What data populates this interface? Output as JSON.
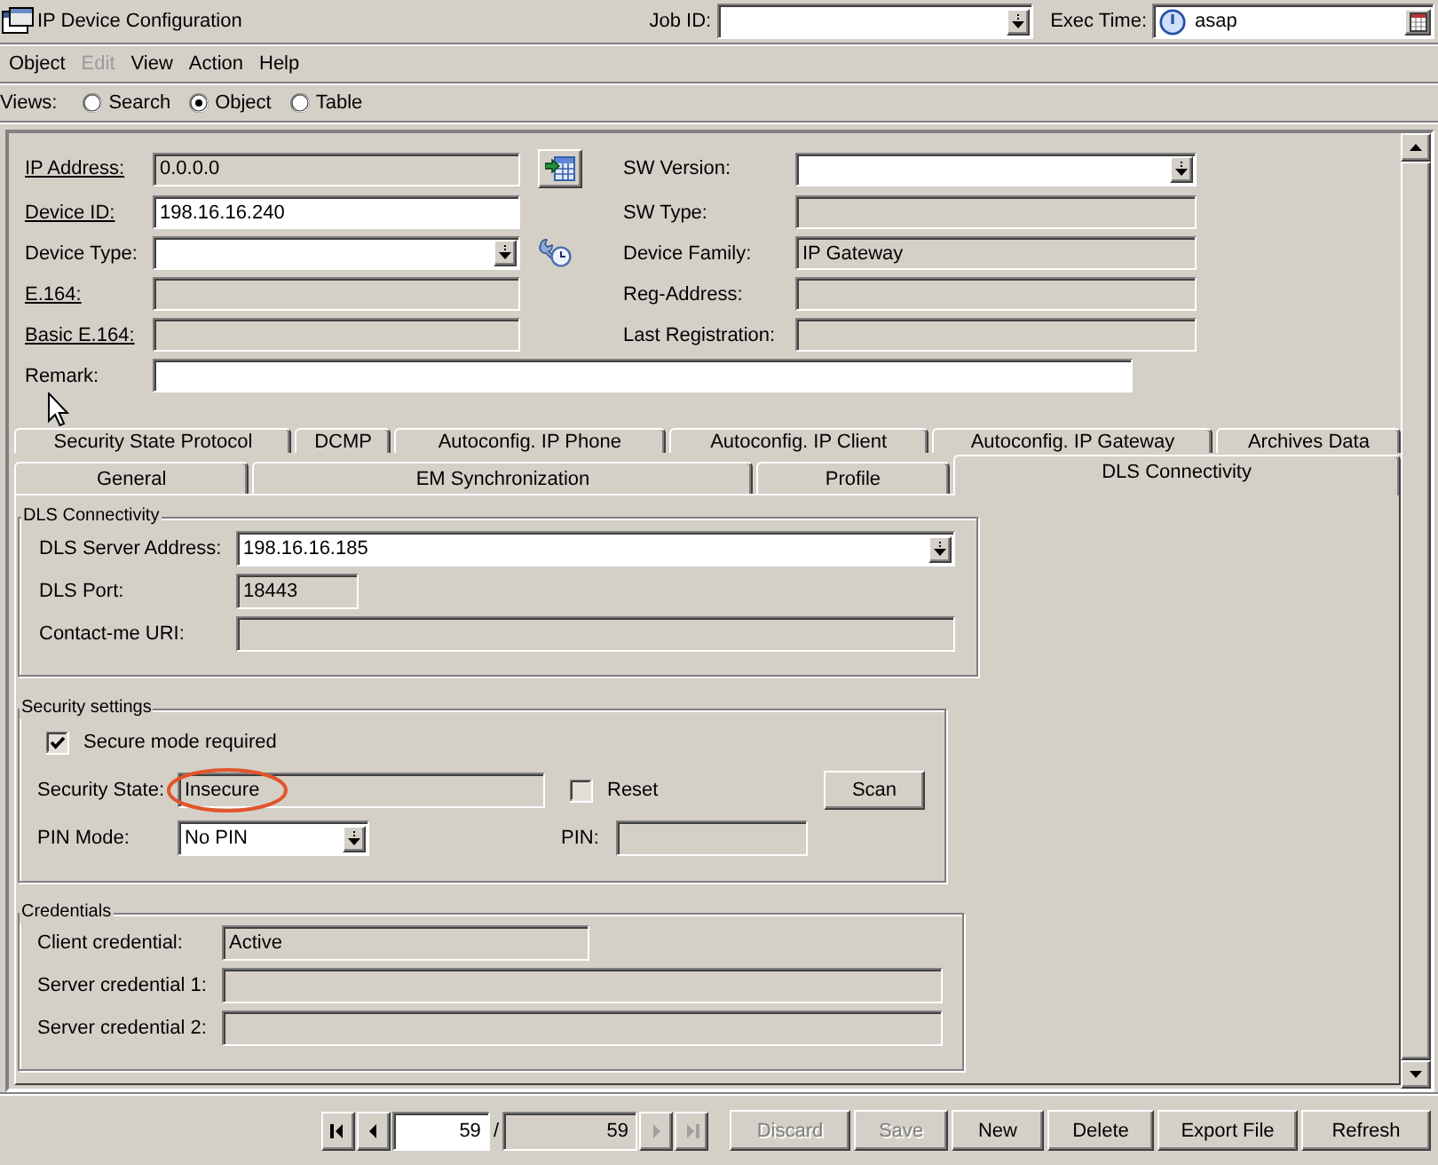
{
  "window": {
    "title": "IP Device Configuration"
  },
  "job_id": {
    "label": "Job ID:"
  },
  "exec_time": {
    "label": "Exec Time:",
    "value": "asap"
  },
  "menu": [
    {
      "label": "Object",
      "disabled": false
    },
    {
      "label": "Edit",
      "disabled": true
    },
    {
      "label": "View",
      "disabled": false
    },
    {
      "label": "Action",
      "disabled": false
    },
    {
      "label": "Help",
      "disabled": false
    }
  ],
  "views": {
    "label": "Views:",
    "options": [
      {
        "label": "Search",
        "selected": false
      },
      {
        "label": "Object",
        "selected": true
      },
      {
        "label": "Table",
        "selected": false
      }
    ]
  },
  "device_form": {
    "left_fields": [
      {
        "label": "IP Address:",
        "value": "0.0.0.0",
        "kind": "readonly",
        "underlined": true,
        "accessory": {
          "kind": "table"
        }
      },
      {
        "label": "Device ID:",
        "value": "198.16.16.240",
        "kind": "text",
        "underlined": true
      },
      {
        "label": "Device Type:",
        "kind": "combo",
        "underlined": false,
        "accessory": {
          "kind": "wrench"
        }
      },
      {
        "label": "E.164:",
        "kind": "readonly",
        "underlined": true
      },
      {
        "label": "Basic E.164:",
        "kind": "readonly",
        "underlined": true
      }
    ],
    "right_fields": [
      {
        "label": "SW Version:",
        "kind": "combo",
        "underlined": false
      },
      {
        "label": "SW Type:",
        "kind": "readonly",
        "underlined": false
      },
      {
        "label": "Device Family:",
        "value": "IP Gateway",
        "kind": "readonly",
        "underlined": false
      },
      {
        "label": "Reg-Address:",
        "kind": "readonly",
        "underlined": false
      },
      {
        "label": "Last Registration:",
        "kind": "readonly",
        "underlined": false
      }
    ],
    "remark": {
      "label": "Remark:",
      "kind": "text"
    }
  },
  "tab_rows": [
    [
      {
        "label": "Security State Protocol",
        "selected": false
      },
      {
        "label": "DCMP",
        "selected": false
      },
      {
        "label": "Autoconfig. IP Phone",
        "selected": false
      },
      {
        "label": "Autoconfig. IP Client",
        "selected": false
      },
      {
        "label": "Autoconfig. IP Gateway",
        "selected": false
      },
      {
        "label": "Archives Data",
        "selected": false
      }
    ],
    [
      {
        "label": "General",
        "selected": false
      },
      {
        "label": "EM Synchronization",
        "selected": false
      },
      {
        "label": "Profile",
        "selected": false
      },
      {
        "label": "DLS Connectivity",
        "selected": true
      }
    ]
  ],
  "dls_connectivity": {
    "title": "DLS Connectivity",
    "fields": [
      {
        "label": "DLS Server Address:",
        "value": "198.16.16.185",
        "kind": "combo"
      },
      {
        "label": "DLS Port:",
        "value": "18443",
        "kind": "readonly"
      },
      {
        "label": "Contact-me URI:",
        "kind": "readonly"
      }
    ]
  },
  "security_settings": {
    "title": "Security settings",
    "secure_mode": {
      "label": "Secure mode required",
      "checked": true
    },
    "security_state": {
      "label": "Security State:",
      "value": "Insecure",
      "highlighted": true
    },
    "reset": {
      "label": "Reset",
      "checked": false
    },
    "scan_button": {
      "label": "Scan"
    },
    "pin_mode": {
      "label": "PIN Mode:",
      "value": "No PIN"
    },
    "pin": {
      "label": "PIN:"
    }
  },
  "credentials": {
    "title": "Credentials",
    "fields": [
      {
        "label": "Client credential:",
        "value": "Active"
      },
      {
        "label": "Server credential 1:"
      },
      {
        "label": "Server credential 2:"
      }
    ]
  },
  "pager": {
    "back": [
      {
        "kind": "first",
        "disabled": false
      },
      {
        "kind": "previous",
        "disabled": false
      }
    ],
    "current": "59",
    "separator": "/",
    "total": "59",
    "forward": [
      {
        "kind": "next",
        "disabled": true
      },
      {
        "kind": "last",
        "disabled": true
      }
    ]
  },
  "buttons": [
    {
      "label": "Discard",
      "disabled": true
    },
    {
      "label": "Save",
      "disabled": true
    },
    {
      "label": "New",
      "disabled": false
    },
    {
      "label": "Delete",
      "disabled": false
    },
    {
      "label": "Export File",
      "disabled": false
    },
    {
      "label": "Refresh",
      "disabled": false
    }
  ]
}
